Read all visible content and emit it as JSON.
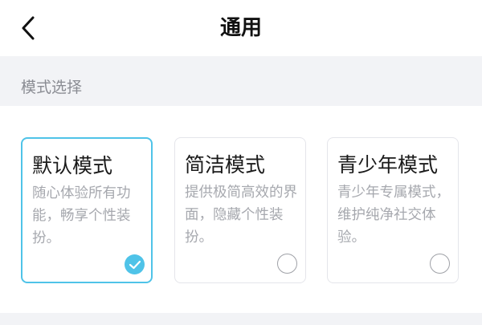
{
  "header": {
    "title": "通用",
    "back_icon": "chevron-left-icon"
  },
  "section": {
    "label": "模式选择"
  },
  "modes": [
    {
      "title": "默认模式",
      "description": "随心体验所有功能，畅享个性装扮。",
      "selected": true
    },
    {
      "title": "简洁模式",
      "description": "提供极简高效的界面，隐藏个性装扮。",
      "selected": false
    },
    {
      "title": "青少年模式",
      "description": "青少年专属模式，维护纯净社交体验。",
      "selected": false
    }
  ],
  "colors": {
    "accent": "#4fc3e8",
    "section_background": "#f2f3f6",
    "muted_text": "#a6a8ae",
    "card_border": "#e4e5ea"
  }
}
